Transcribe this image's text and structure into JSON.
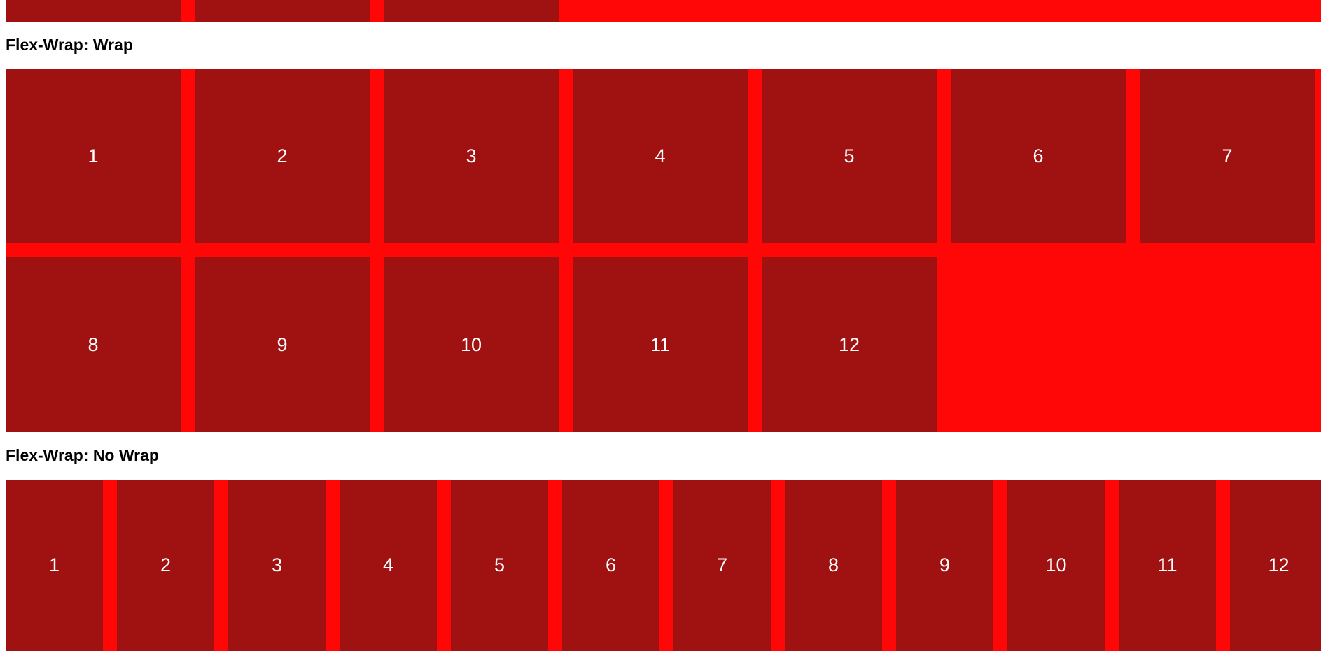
{
  "colors": {
    "container_bg": "#ff0707",
    "item_bg": "#a01111",
    "item_text": "#ffffff",
    "heading_text": "#000000"
  },
  "top_section": {
    "items": [
      "",
      "",
      ""
    ]
  },
  "wrap_section": {
    "heading": "Flex-Wrap: Wrap",
    "items": [
      "1",
      "2",
      "3",
      "4",
      "5",
      "6",
      "7",
      "8",
      "9",
      "10",
      "11",
      "12"
    ]
  },
  "nowrap_section": {
    "heading": "Flex-Wrap: No Wrap",
    "items": [
      "1",
      "2",
      "3",
      "4",
      "5",
      "6",
      "7",
      "8",
      "9",
      "10",
      "11",
      "12"
    ]
  }
}
